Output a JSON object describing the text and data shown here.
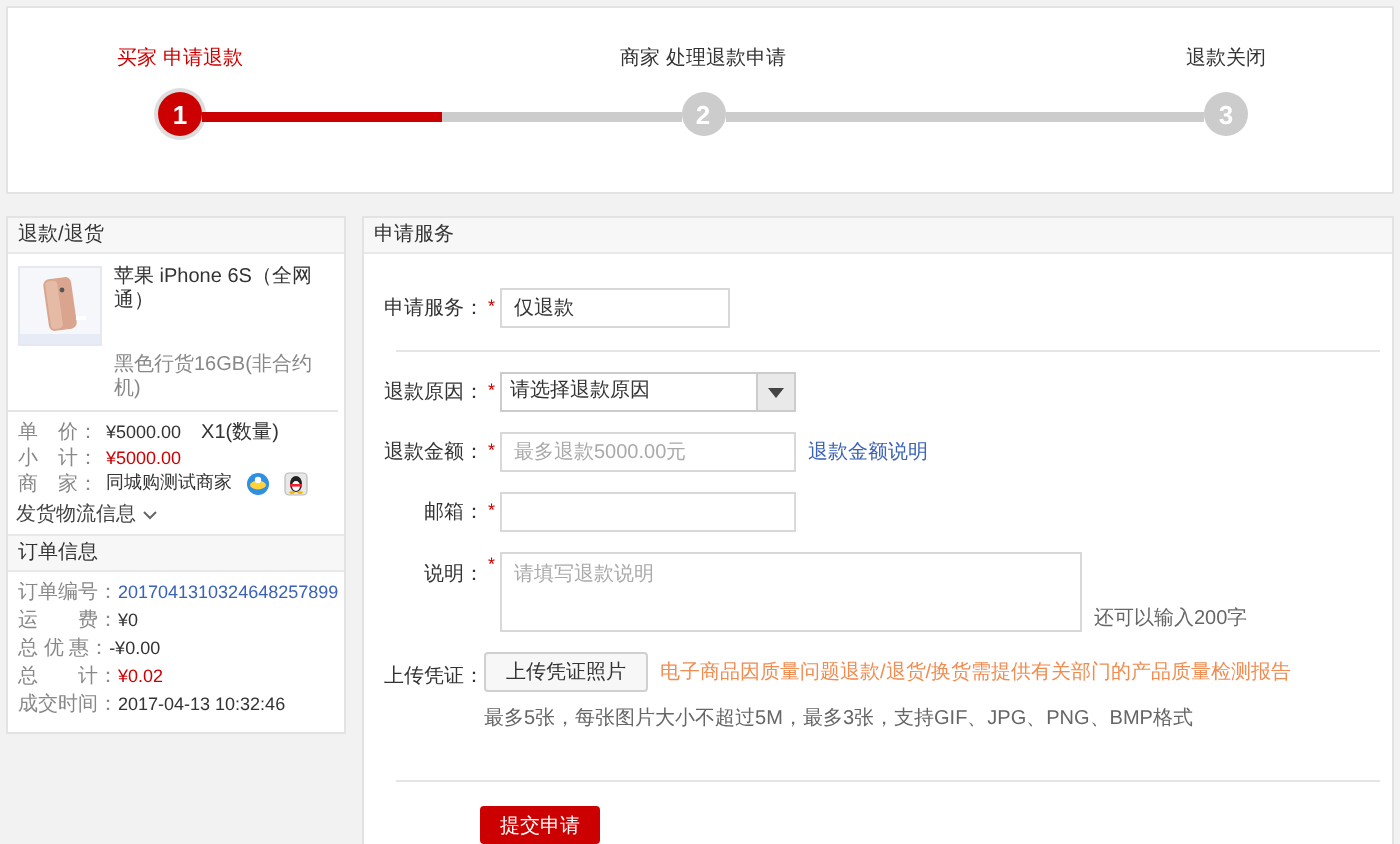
{
  "steps": {
    "connectors": [
      {
        "level": 0.5
      }
    ],
    "items": [
      {
        "number": "1",
        "label": "买家 申请退款",
        "selected": true
      },
      {
        "number": "2",
        "label": "商家 处理退款申请",
        "selected": false
      },
      {
        "number": "3",
        "label": "退款关闭",
        "selected": false
      }
    ]
  },
  "refund_panel": {
    "title": "退款/退货",
    "product": {
      "kind": "picture",
      "name": "苹果 iPhone 6S（全网通）",
      "variant": "黑色行货16GB(非合约机)"
    },
    "details": [
      {
        "kind": "plain",
        "label": "单　价：",
        "value": "¥5000.00",
        "extra": "X1(数量)"
      },
      {
        "kind": "price",
        "label": "小　计：",
        "value": "¥5000.00"
      },
      {
        "kind": "merchant",
        "label": "商　家：",
        "value": "同城购测试商家"
      }
    ],
    "shipping": {
      "label": "发货物流信息",
      "expanded": false
    }
  },
  "order_info": {
    "title": "订单信息",
    "rows": [
      {
        "kind": "link",
        "label": "订单编号：",
        "value": "2017041310324648257899"
      },
      {
        "kind": "plain",
        "label": "运　　费：",
        "value": "¥0"
      },
      {
        "kind": "plain",
        "label": "总 优 惠：",
        "value": "-¥0.00"
      },
      {
        "kind": "price",
        "label": "总　　计：",
        "value": "¥0.02"
      },
      {
        "kind": "plain",
        "label": "成交时间：",
        "value": "2017-04-13 10:32:46"
      }
    ]
  },
  "form": {
    "title": "申请服务",
    "required_mark": "*",
    "service": {
      "label": "申请服务：",
      "required": true,
      "value": "仅退款"
    },
    "fields": [
      {
        "kind": "select",
        "label": "退款原因：",
        "required": true,
        "value": "请选择退款原因"
      },
      {
        "kind": "text",
        "label": "退款金额：",
        "required": true,
        "placeholder": "最多退款5000.00元",
        "link": "退款金额说明"
      },
      {
        "kind": "text",
        "label": "邮箱：",
        "required": true
      },
      {
        "kind": "textarea",
        "label": "说明：",
        "required": true,
        "placeholder": "请填写退款说明",
        "note": "还可以输入200字"
      },
      {
        "kind": "upload",
        "label": "上传凭证：",
        "required": false,
        "button": "上传凭证照片",
        "warning": "电子商品因质量问题退款/退货/换货需提供有关部门的产品质量检测报告",
        "hint": "最多5张，每张图片大小不超过5M，最多3张，支持GIF、JPG、PNG、BMP格式"
      }
    ],
    "submit": "提交申请"
  }
}
